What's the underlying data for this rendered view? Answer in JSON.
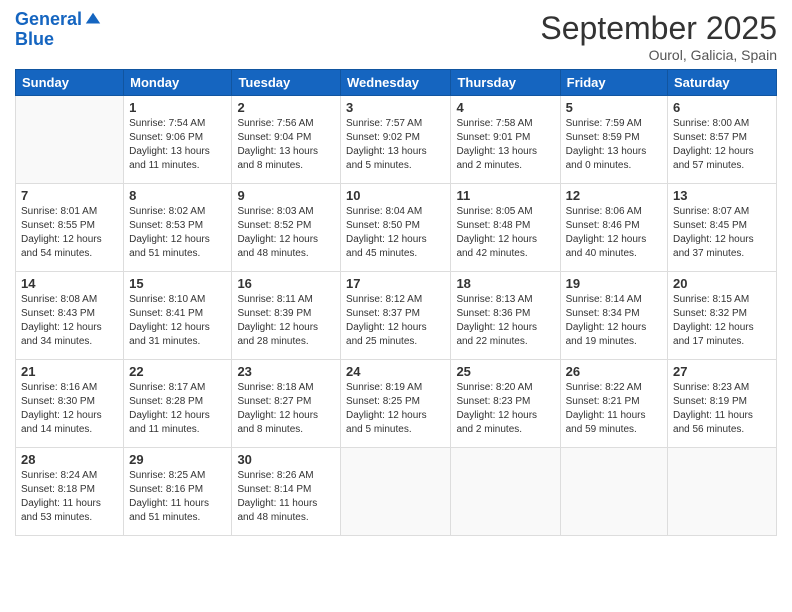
{
  "logo": {
    "line1": "General",
    "line2": "Blue"
  },
  "title": "September 2025",
  "location": "Ourol, Galicia, Spain",
  "weekdays": [
    "Sunday",
    "Monday",
    "Tuesday",
    "Wednesday",
    "Thursday",
    "Friday",
    "Saturday"
  ],
  "weeks": [
    [
      {
        "day": "",
        "sunrise": "",
        "sunset": "",
        "daylight": ""
      },
      {
        "day": "1",
        "sunrise": "Sunrise: 7:54 AM",
        "sunset": "Sunset: 9:06 PM",
        "daylight": "Daylight: 13 hours and 11 minutes."
      },
      {
        "day": "2",
        "sunrise": "Sunrise: 7:56 AM",
        "sunset": "Sunset: 9:04 PM",
        "daylight": "Daylight: 13 hours and 8 minutes."
      },
      {
        "day": "3",
        "sunrise": "Sunrise: 7:57 AM",
        "sunset": "Sunset: 9:02 PM",
        "daylight": "Daylight: 13 hours and 5 minutes."
      },
      {
        "day": "4",
        "sunrise": "Sunrise: 7:58 AM",
        "sunset": "Sunset: 9:01 PM",
        "daylight": "Daylight: 13 hours and 2 minutes."
      },
      {
        "day": "5",
        "sunrise": "Sunrise: 7:59 AM",
        "sunset": "Sunset: 8:59 PM",
        "daylight": "Daylight: 13 hours and 0 minutes."
      },
      {
        "day": "6",
        "sunrise": "Sunrise: 8:00 AM",
        "sunset": "Sunset: 8:57 PM",
        "daylight": "Daylight: 12 hours and 57 minutes."
      }
    ],
    [
      {
        "day": "7",
        "sunrise": "Sunrise: 8:01 AM",
        "sunset": "Sunset: 8:55 PM",
        "daylight": "Daylight: 12 hours and 54 minutes."
      },
      {
        "day": "8",
        "sunrise": "Sunrise: 8:02 AM",
        "sunset": "Sunset: 8:53 PM",
        "daylight": "Daylight: 12 hours and 51 minutes."
      },
      {
        "day": "9",
        "sunrise": "Sunrise: 8:03 AM",
        "sunset": "Sunset: 8:52 PM",
        "daylight": "Daylight: 12 hours and 48 minutes."
      },
      {
        "day": "10",
        "sunrise": "Sunrise: 8:04 AM",
        "sunset": "Sunset: 8:50 PM",
        "daylight": "Daylight: 12 hours and 45 minutes."
      },
      {
        "day": "11",
        "sunrise": "Sunrise: 8:05 AM",
        "sunset": "Sunset: 8:48 PM",
        "daylight": "Daylight: 12 hours and 42 minutes."
      },
      {
        "day": "12",
        "sunrise": "Sunrise: 8:06 AM",
        "sunset": "Sunset: 8:46 PM",
        "daylight": "Daylight: 12 hours and 40 minutes."
      },
      {
        "day": "13",
        "sunrise": "Sunrise: 8:07 AM",
        "sunset": "Sunset: 8:45 PM",
        "daylight": "Daylight: 12 hours and 37 minutes."
      }
    ],
    [
      {
        "day": "14",
        "sunrise": "Sunrise: 8:08 AM",
        "sunset": "Sunset: 8:43 PM",
        "daylight": "Daylight: 12 hours and 34 minutes."
      },
      {
        "day": "15",
        "sunrise": "Sunrise: 8:10 AM",
        "sunset": "Sunset: 8:41 PM",
        "daylight": "Daylight: 12 hours and 31 minutes."
      },
      {
        "day": "16",
        "sunrise": "Sunrise: 8:11 AM",
        "sunset": "Sunset: 8:39 PM",
        "daylight": "Daylight: 12 hours and 28 minutes."
      },
      {
        "day": "17",
        "sunrise": "Sunrise: 8:12 AM",
        "sunset": "Sunset: 8:37 PM",
        "daylight": "Daylight: 12 hours and 25 minutes."
      },
      {
        "day": "18",
        "sunrise": "Sunrise: 8:13 AM",
        "sunset": "Sunset: 8:36 PM",
        "daylight": "Daylight: 12 hours and 22 minutes."
      },
      {
        "day": "19",
        "sunrise": "Sunrise: 8:14 AM",
        "sunset": "Sunset: 8:34 PM",
        "daylight": "Daylight: 12 hours and 19 minutes."
      },
      {
        "day": "20",
        "sunrise": "Sunrise: 8:15 AM",
        "sunset": "Sunset: 8:32 PM",
        "daylight": "Daylight: 12 hours and 17 minutes."
      }
    ],
    [
      {
        "day": "21",
        "sunrise": "Sunrise: 8:16 AM",
        "sunset": "Sunset: 8:30 PM",
        "daylight": "Daylight: 12 hours and 14 minutes."
      },
      {
        "day": "22",
        "sunrise": "Sunrise: 8:17 AM",
        "sunset": "Sunset: 8:28 PM",
        "daylight": "Daylight: 12 hours and 11 minutes."
      },
      {
        "day": "23",
        "sunrise": "Sunrise: 8:18 AM",
        "sunset": "Sunset: 8:27 PM",
        "daylight": "Daylight: 12 hours and 8 minutes."
      },
      {
        "day": "24",
        "sunrise": "Sunrise: 8:19 AM",
        "sunset": "Sunset: 8:25 PM",
        "daylight": "Daylight: 12 hours and 5 minutes."
      },
      {
        "day": "25",
        "sunrise": "Sunrise: 8:20 AM",
        "sunset": "Sunset: 8:23 PM",
        "daylight": "Daylight: 12 hours and 2 minutes."
      },
      {
        "day": "26",
        "sunrise": "Sunrise: 8:22 AM",
        "sunset": "Sunset: 8:21 PM",
        "daylight": "Daylight: 11 hours and 59 minutes."
      },
      {
        "day": "27",
        "sunrise": "Sunrise: 8:23 AM",
        "sunset": "Sunset: 8:19 PM",
        "daylight": "Daylight: 11 hours and 56 minutes."
      }
    ],
    [
      {
        "day": "28",
        "sunrise": "Sunrise: 8:24 AM",
        "sunset": "Sunset: 8:18 PM",
        "daylight": "Daylight: 11 hours and 53 minutes."
      },
      {
        "day": "29",
        "sunrise": "Sunrise: 8:25 AM",
        "sunset": "Sunset: 8:16 PM",
        "daylight": "Daylight: 11 hours and 51 minutes."
      },
      {
        "day": "30",
        "sunrise": "Sunrise: 8:26 AM",
        "sunset": "Sunset: 8:14 PM",
        "daylight": "Daylight: 11 hours and 48 minutes."
      },
      {
        "day": "",
        "sunrise": "",
        "sunset": "",
        "daylight": ""
      },
      {
        "day": "",
        "sunrise": "",
        "sunset": "",
        "daylight": ""
      },
      {
        "day": "",
        "sunrise": "",
        "sunset": "",
        "daylight": ""
      },
      {
        "day": "",
        "sunrise": "",
        "sunset": "",
        "daylight": ""
      }
    ]
  ]
}
